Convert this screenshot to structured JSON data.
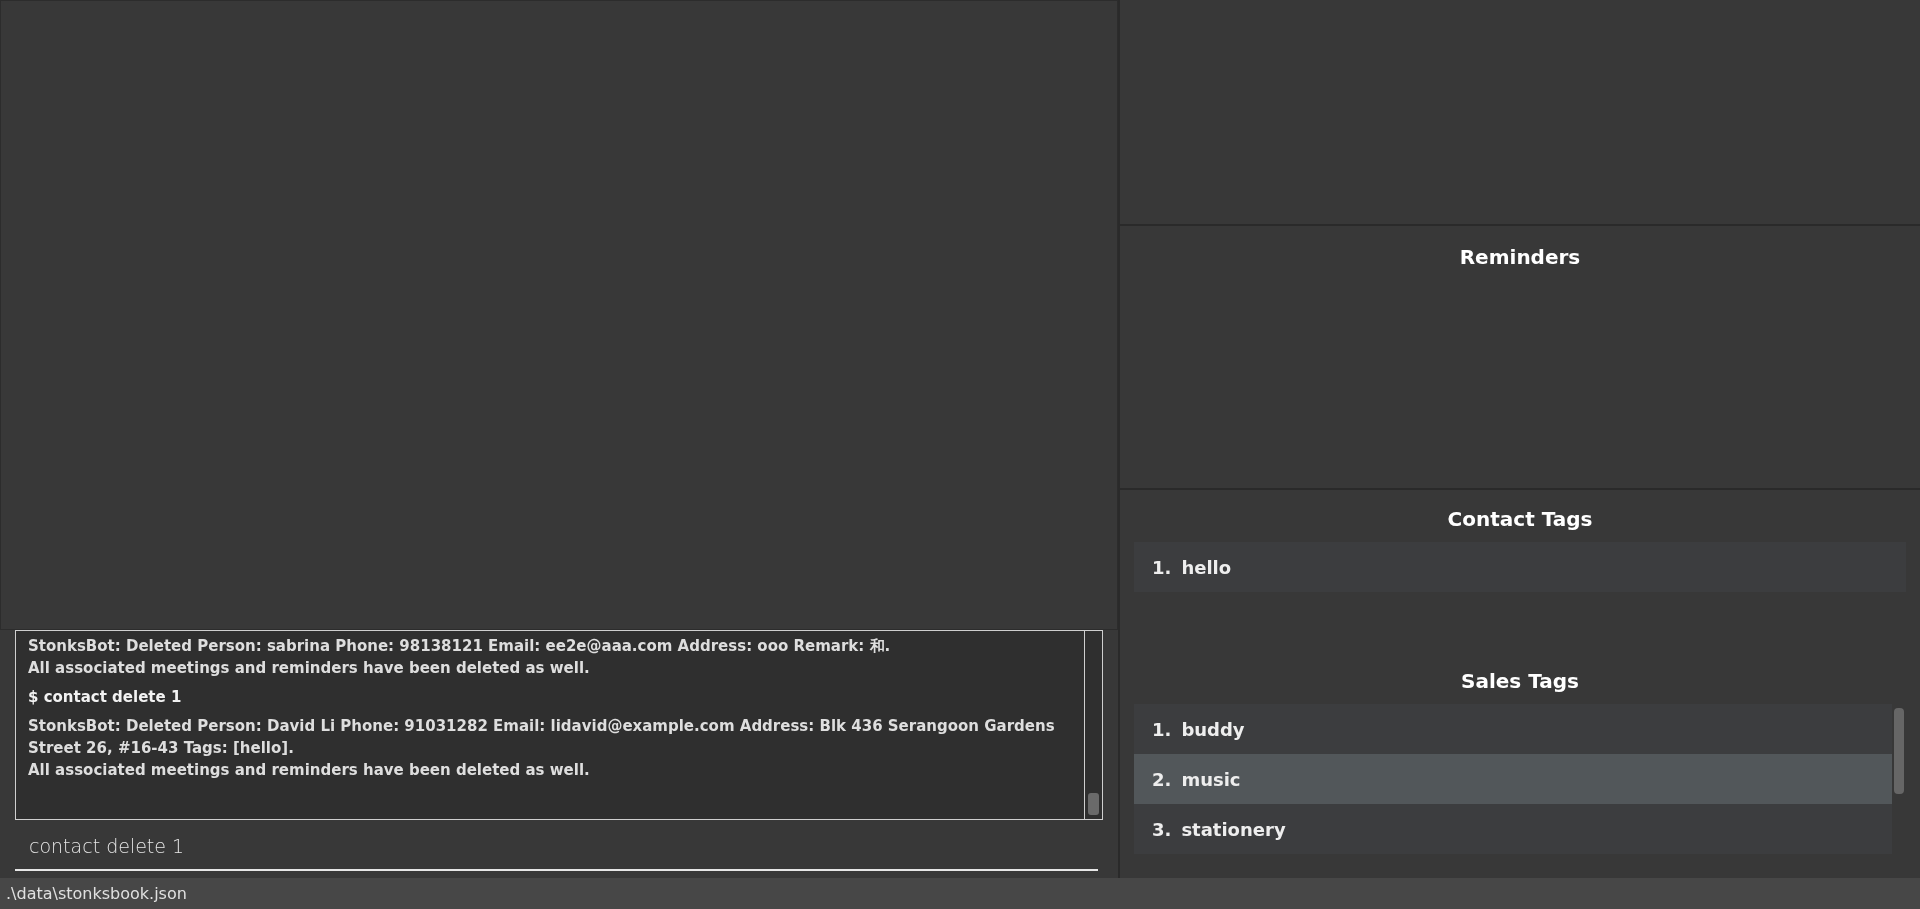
{
  "result_log": [
    {
      "kind": "response",
      "lines": [
        "StonksBot: Deleted Person: sabrina Phone: 98138121 Email: ee2e@aaa.com Address: ooo Remark: 和.",
        "All associated meetings and reminders have been deleted as well."
      ]
    },
    {
      "kind": "command",
      "lines": [
        "$ contact delete 1"
      ]
    },
    {
      "kind": "response",
      "lines": [
        "StonksBot: Deleted Person: David Li Phone: 91031282 Email: lidavid@example.com Address: Blk 436 Serangoon Gardens Street 26, #16-43 Tags: [hello].",
        "All associated meetings and reminders have been deleted as well."
      ]
    }
  ],
  "command_input": {
    "value": "contact delete 1"
  },
  "reminders": {
    "title": "Reminders"
  },
  "contact_tags": {
    "title": "Contact Tags",
    "items": [
      {
        "index": "1.",
        "label": "hello",
        "selected": false
      }
    ]
  },
  "sales_tags": {
    "title": "Sales Tags",
    "items": [
      {
        "index": "1.",
        "label": "buddy",
        "selected": false
      },
      {
        "index": "2.",
        "label": "music",
        "selected": true
      },
      {
        "index": "3.",
        "label": "stationery",
        "selected": false
      }
    ]
  },
  "status_bar": {
    "path": ".\\data\\stonksbook.json"
  }
}
